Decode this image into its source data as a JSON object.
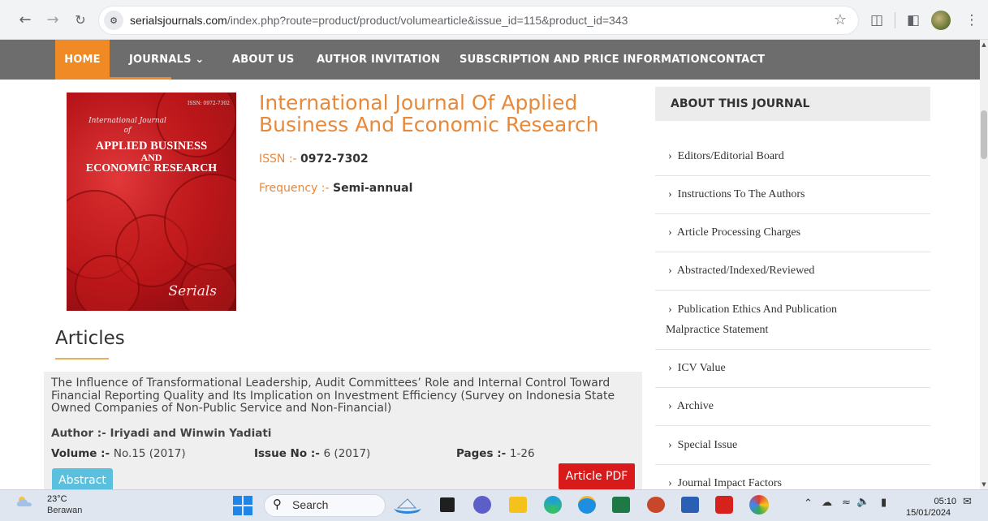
{
  "browser": {
    "url_host": "serialsjournals.com",
    "url_path": "/index.php?route=product/product/volumearticle&issue_id=115&product_id=343"
  },
  "site_nav": {
    "items": [
      {
        "label": "HOME",
        "active": true
      },
      {
        "label": "JOURNALS  ⌄",
        "active": false
      },
      {
        "label": "ABOUT US",
        "active": false
      },
      {
        "label": "AUTHOR INVITATION",
        "active": false
      },
      {
        "label": "SUBSCRIPTION AND PRICE INFORMATION",
        "active": false
      },
      {
        "label": "CONTACT",
        "active": false
      }
    ]
  },
  "journal": {
    "cover": {
      "issn": "ISSN: 0972-7302",
      "line1": "International Journal",
      "line2": "of",
      "title1": "APPLIED BUSINESS",
      "title2": "AND",
      "title3": "ECONOMIC RESEARCH",
      "publisher_mark": "Serials"
    },
    "title": "International Journal Of Applied Business And Economic Research",
    "issn_label": "ISSN :- ",
    "issn_value": "0972-7302",
    "frequency_label": "Frequency :- ",
    "frequency_value": "Semi-annual"
  },
  "articles": {
    "heading": "Articles",
    "items": [
      {
        "title": "The Influence of Transformational Leadership, Audit Committees’ Role and Internal Control Toward Financial Reporting Quality and Its Implication on Investment Efficiency (Survey on Indonesia State Owned Companies of Non-Public Service and Non-Financial)",
        "author": "Author :- Iriyadi and Winwin Yadiati",
        "volume_label": "Volume :- ",
        "volume_value": "No.15 (2017)",
        "issue_label": "Issue No :- ",
        "issue_value": "6 (2017)",
        "pages_label": "Pages :- ",
        "pages_value": "1-26",
        "pdf_button": "Article PDF",
        "abstract_button": "Abstract"
      }
    ]
  },
  "sidebar": {
    "heading": "ABOUT THIS JOURNAL",
    "items": [
      {
        "label": "Editors/Editorial Board"
      },
      {
        "label": "Instructions To The Authors"
      },
      {
        "label": "Article Processing Charges"
      },
      {
        "label": "Abstracted/Indexed/Reviewed"
      },
      {
        "label": "Publication Ethics And Publication",
        "label2": "Malpractice Statement"
      },
      {
        "label": "ICV Value"
      },
      {
        "label": "Archive"
      },
      {
        "label": "Special Issue"
      },
      {
        "label": "Journal Impact Factors"
      }
    ],
    "chevron": "›"
  },
  "taskbar": {
    "temperature": "23°C",
    "condition": "Berawan",
    "search_placeholder": "Search",
    "time": "05:10",
    "date": "15/01/2024"
  }
}
